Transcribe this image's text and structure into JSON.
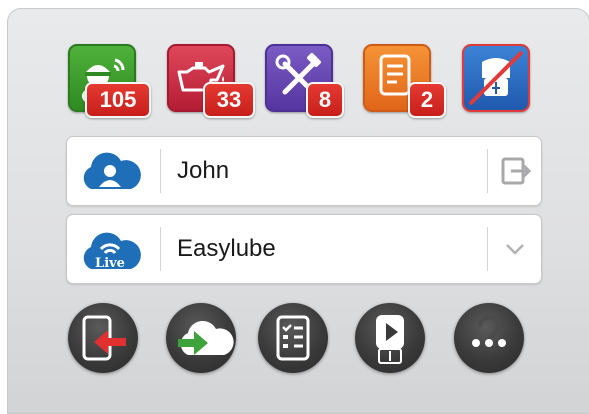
{
  "badges": {
    "oil_analysis": "105",
    "lubrication": "33",
    "maintenance": "8",
    "report": "2"
  },
  "user": {
    "name": "John"
  },
  "workspace": {
    "name": "Easylube",
    "live_label": "Live"
  },
  "colors": {
    "tile_green": "#3f9a2e",
    "tile_crimson": "#c8283e",
    "tile_purple": "#6a4bb0",
    "tile_orange": "#ee7a1e",
    "tile_blue": "#2f6fc3",
    "badge_red": "#d22a24",
    "cloud_blue": "#1f6fb8",
    "button_dark": "#3a3a3a"
  }
}
